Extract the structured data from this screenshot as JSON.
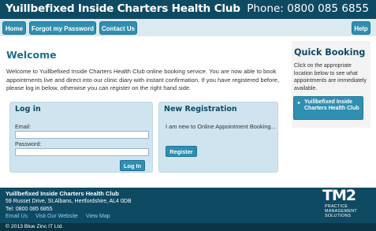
{
  "header": {
    "title": "Yuillbefixed Inside Charters Health Club",
    "phone": "Phone: 0800 085 6855"
  },
  "nav": {
    "home": "Home",
    "forgot": "Forgot my Password",
    "contact": "Contact Us",
    "help": "Help"
  },
  "main": {
    "welcome": "Welcome",
    "intro": "Welcome to Yuillbefixed Inside Charters Health Club online booking service. You are now able to book appointments live and direct into our clinic diary with instant confirmation. If you have registered before, please log in below, otherwise you can register on the right hand side."
  },
  "login": {
    "title": "Log in",
    "email_label": "Email:",
    "email_value": "",
    "password_label": "Password:",
    "password_value": "",
    "button": "Log In"
  },
  "register": {
    "title": "New Registration",
    "text": "I am new to Online Appointment Booking...",
    "button": "Register"
  },
  "sidebar": {
    "title": "Quick Booking",
    "text": "Click on the appropriate location below to see what appointments are immediately available.",
    "location": "Yuillbefixed Inside Charters Health Club"
  },
  "footer": {
    "name": "Yuillbefixed Inside Charters Health Club",
    "address": "59 Russet Drive, St.Albans, Hertfordshire, AL4 0DB",
    "tel": "Tel: 0800 085 6855",
    "links": [
      "Email Us",
      "Visit Our Website",
      "View Map"
    ],
    "logo_big": "TM2",
    "logo_line1": "PRACTICE",
    "logo_line2": "MANAGEMENT",
    "logo_line3": "SOLUTIONS",
    "copyright": "© 2013 Blue Zinc IT Ltd."
  },
  "colors": {
    "header_bg": "#0f4a63",
    "nav_bg": "#dbeaf0",
    "button_bg": "#2f8fb2",
    "panel_bg": "#cfe4ee",
    "heading": "#1d6f93",
    "link": "#8fd1ee"
  }
}
